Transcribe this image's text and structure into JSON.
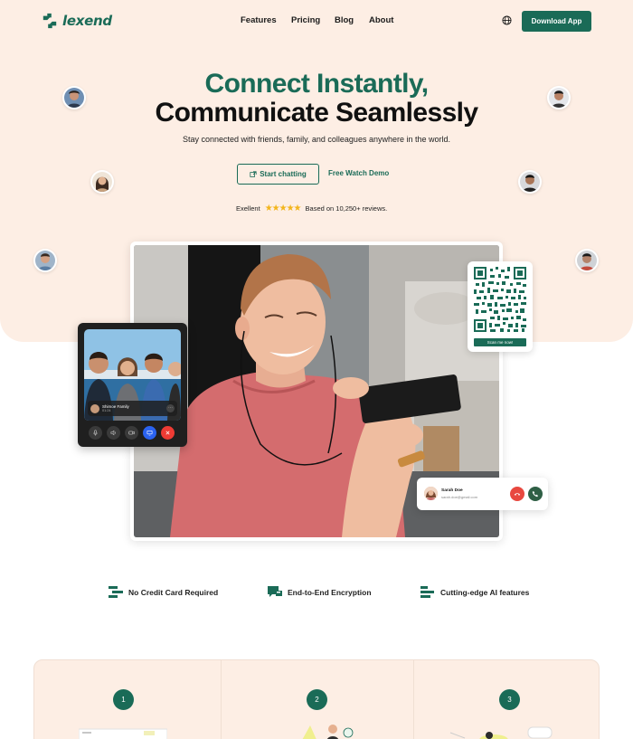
{
  "brand": {
    "name": "lexend",
    "color": "#1a6b57"
  },
  "nav": {
    "items": [
      "Features",
      "Pricing",
      "Blog",
      "About"
    ],
    "download_label": "Download App"
  },
  "hero": {
    "title_line1": "Connect Instantly,",
    "title_line2": "Communicate Seamlessly",
    "subtitle": "Stay connected with friends, family, and colleagues anywhere in the world.",
    "primary_cta": "Start chatting",
    "secondary_cta": "Free Watch Demo",
    "rating_label": "Exellent",
    "rating_stars": 5,
    "rating_text": "Based on 10,250+ reviews."
  },
  "video_card": {
    "caller_name": "Shimoe Family",
    "caller_time": "01:24"
  },
  "qr_card": {
    "button_label": "Scan me now!"
  },
  "call_card": {
    "name": "Sarah Doe",
    "email": "sarah.doe@gmail.com"
  },
  "features": [
    {
      "label": "No Credit Card Required",
      "icon": "card-icon"
    },
    {
      "label": "End-to-End Encryption",
      "icon": "chat-icon"
    },
    {
      "label": "Cutting-edge AI features",
      "icon": "bars-icon"
    }
  ],
  "steps": [
    "1",
    "2",
    "3"
  ],
  "colors": {
    "accent": "#1a6b57",
    "hero_bg": "#fdeee4",
    "star": "#f3b51c",
    "end_call": "#ee3b34",
    "video_blue": "#2b63f0"
  }
}
